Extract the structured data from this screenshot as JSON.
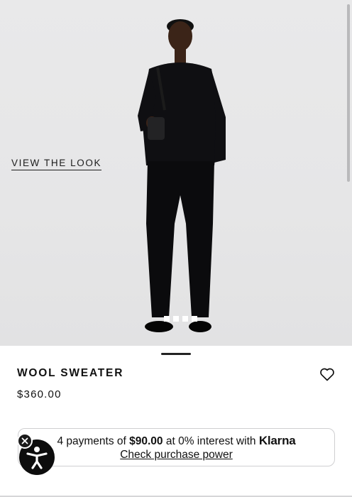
{
  "hero": {
    "view_look_label": "VIEW THE LOOK",
    "carousel_slides": 4,
    "carousel_active_index": 0
  },
  "product": {
    "name": "WOOL SWEATER",
    "price": "$360.00"
  },
  "klarna": {
    "count_text": "4 payments of ",
    "amount": "$90.00",
    "rate_text": " at 0% interest with ",
    "brand": "Klarna",
    "link_label": "Check purchase power"
  },
  "icons": {
    "wishlist": "heart-outline-icon",
    "accessibility": "accessibility-person-icon",
    "close": "close-icon"
  },
  "colors": {
    "hero_background": "#e7e7e8",
    "text": "#111111",
    "accessibility_button": "#0d0d0d"
  }
}
